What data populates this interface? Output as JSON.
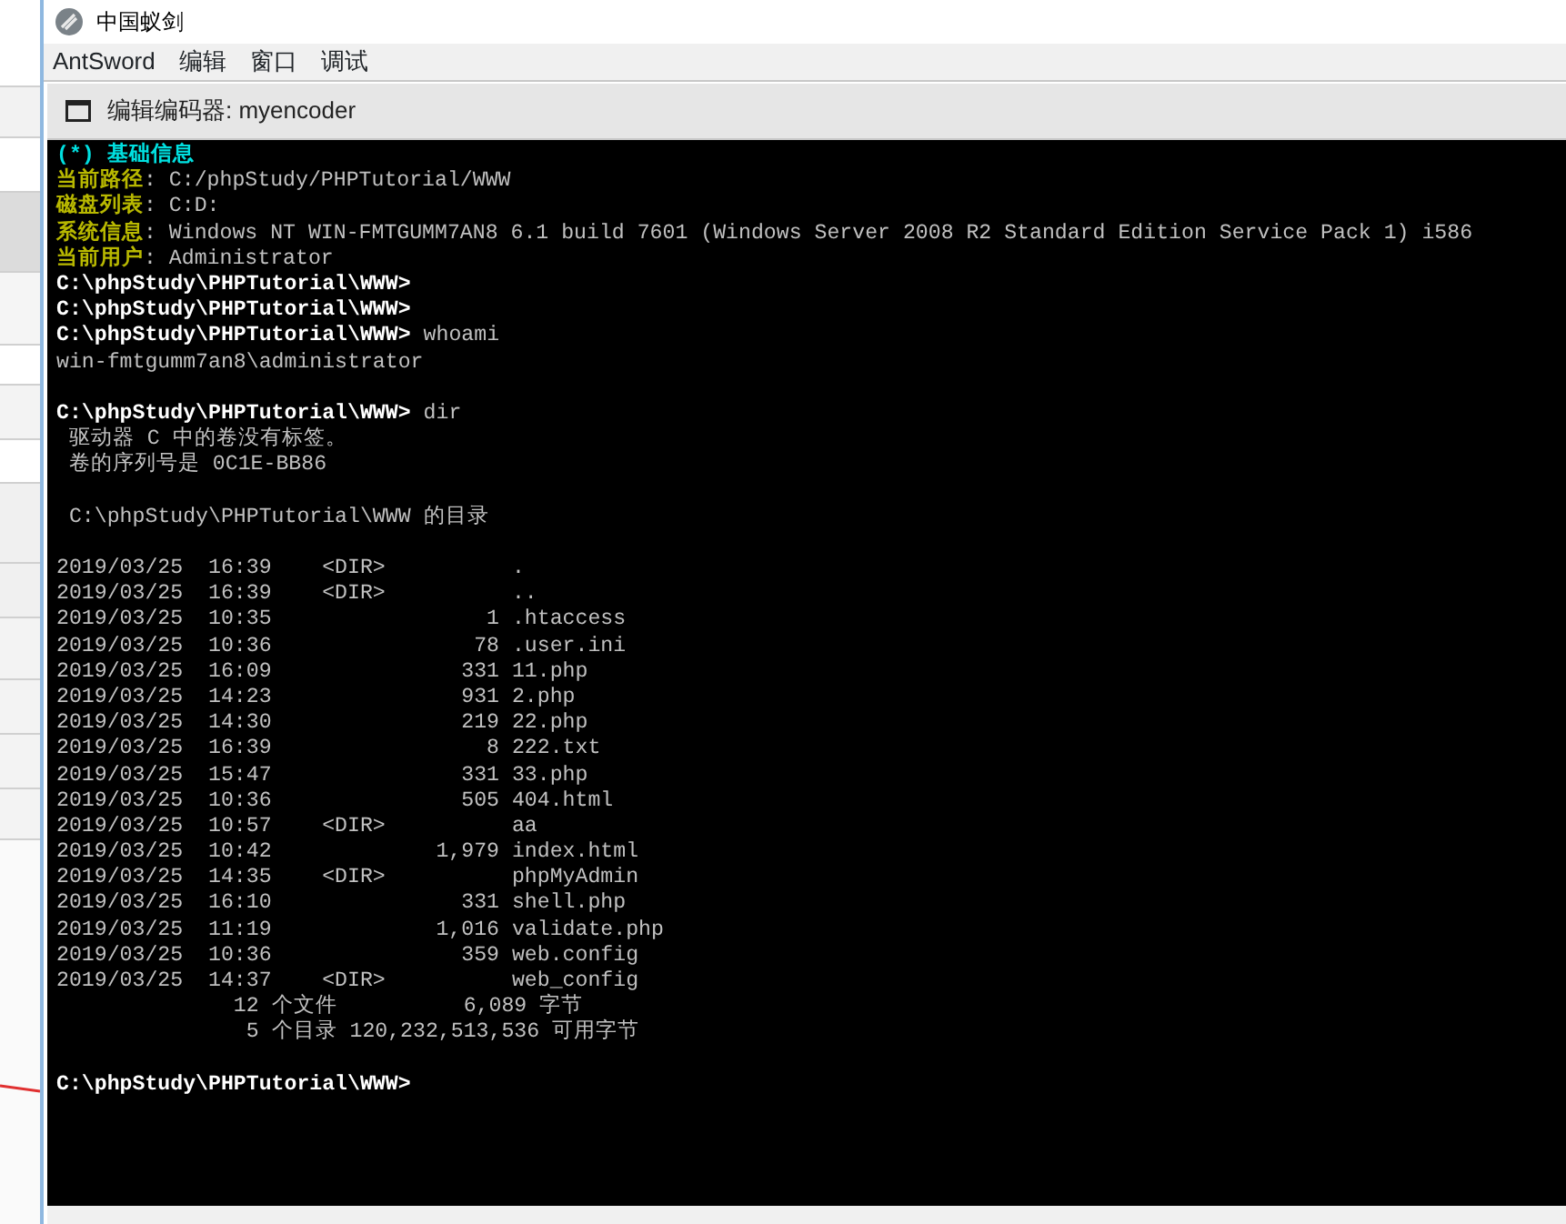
{
  "window": {
    "title": "中国蚁剑"
  },
  "menu": [
    "AntSword",
    "编辑",
    "窗口",
    "调试"
  ],
  "panel": {
    "title": "编辑编码器: myencoder"
  },
  "terminal": {
    "lines": [
      {
        "kind": "heading",
        "text": "(*) 基础信息"
      },
      {
        "kind": "info",
        "label": "当前路径",
        "value": ": C:/phpStudy/PHPTutorial/WWW"
      },
      {
        "kind": "info",
        "label": "磁盘列表",
        "value": ": C:D:"
      },
      {
        "kind": "info",
        "label": "系统信息",
        "value": ": Windows NT WIN-FMTGUMM7AN8 6.1 build 7601 (Windows Server 2008 R2 Standard Edition Service Pack 1) i586"
      },
      {
        "kind": "info",
        "label": "当前用户",
        "value": ": Administrator"
      },
      {
        "kind": "prompt",
        "prompt": "C:\\phpStudy\\PHPTutorial\\WWW>"
      },
      {
        "kind": "prompt",
        "prompt": "C:\\phpStudy\\PHPTutorial\\WWW>"
      },
      {
        "kind": "prompt",
        "prompt": "C:\\phpStudy\\PHPTutorial\\WWW>",
        "command": "whoami"
      },
      {
        "kind": "output",
        "text": "win-fmtgumm7an8\\administrator"
      },
      {
        "kind": "blank"
      },
      {
        "kind": "prompt",
        "prompt": "C:\\phpStudy\\PHPTutorial\\WWW>",
        "command": "dir"
      },
      {
        "kind": "output",
        "text": " 驱动器 C 中的卷没有标签。"
      },
      {
        "kind": "output",
        "text": " 卷的序列号是 0C1E-BB86"
      },
      {
        "kind": "blank"
      },
      {
        "kind": "output",
        "text": " C:\\phpStudy\\PHPTutorial\\WWW 的目录"
      },
      {
        "kind": "blank"
      },
      {
        "kind": "output",
        "text": "2019/03/25  16:39    <DIR>          ."
      },
      {
        "kind": "output",
        "text": "2019/03/25  16:39    <DIR>          .."
      },
      {
        "kind": "output",
        "text": "2019/03/25  10:35                 1 .htaccess"
      },
      {
        "kind": "output",
        "text": "2019/03/25  10:36                78 .user.ini"
      },
      {
        "kind": "output",
        "text": "2019/03/25  16:09               331 11.php"
      },
      {
        "kind": "output",
        "text": "2019/03/25  14:23               931 2.php"
      },
      {
        "kind": "output",
        "text": "2019/03/25  14:30               219 22.php"
      },
      {
        "kind": "output",
        "text": "2019/03/25  16:39                 8 222.txt"
      },
      {
        "kind": "output",
        "text": "2019/03/25  15:47               331 33.php"
      },
      {
        "kind": "output",
        "text": "2019/03/25  10:36               505 404.html"
      },
      {
        "kind": "output",
        "text": "2019/03/25  10:57    <DIR>          aa"
      },
      {
        "kind": "output",
        "text": "2019/03/25  10:42             1,979 index.html"
      },
      {
        "kind": "output",
        "text": "2019/03/25  14:35    <DIR>          phpMyAdmin"
      },
      {
        "kind": "output",
        "text": "2019/03/25  16:10               331 shell.php"
      },
      {
        "kind": "output",
        "text": "2019/03/25  11:19             1,016 validate.php"
      },
      {
        "kind": "output",
        "text": "2019/03/25  10:36               359 web.config"
      },
      {
        "kind": "output",
        "text": "2019/03/25  14:37    <DIR>          web_config"
      },
      {
        "kind": "output",
        "text": "              12 个文件          6,089 字节"
      },
      {
        "kind": "output",
        "text": "               5 个目录 120,232,513,536 可用字节"
      },
      {
        "kind": "blank"
      },
      {
        "kind": "prompt",
        "prompt": "C:\\phpStudy\\PHPTutorial\\WWW>"
      }
    ]
  }
}
